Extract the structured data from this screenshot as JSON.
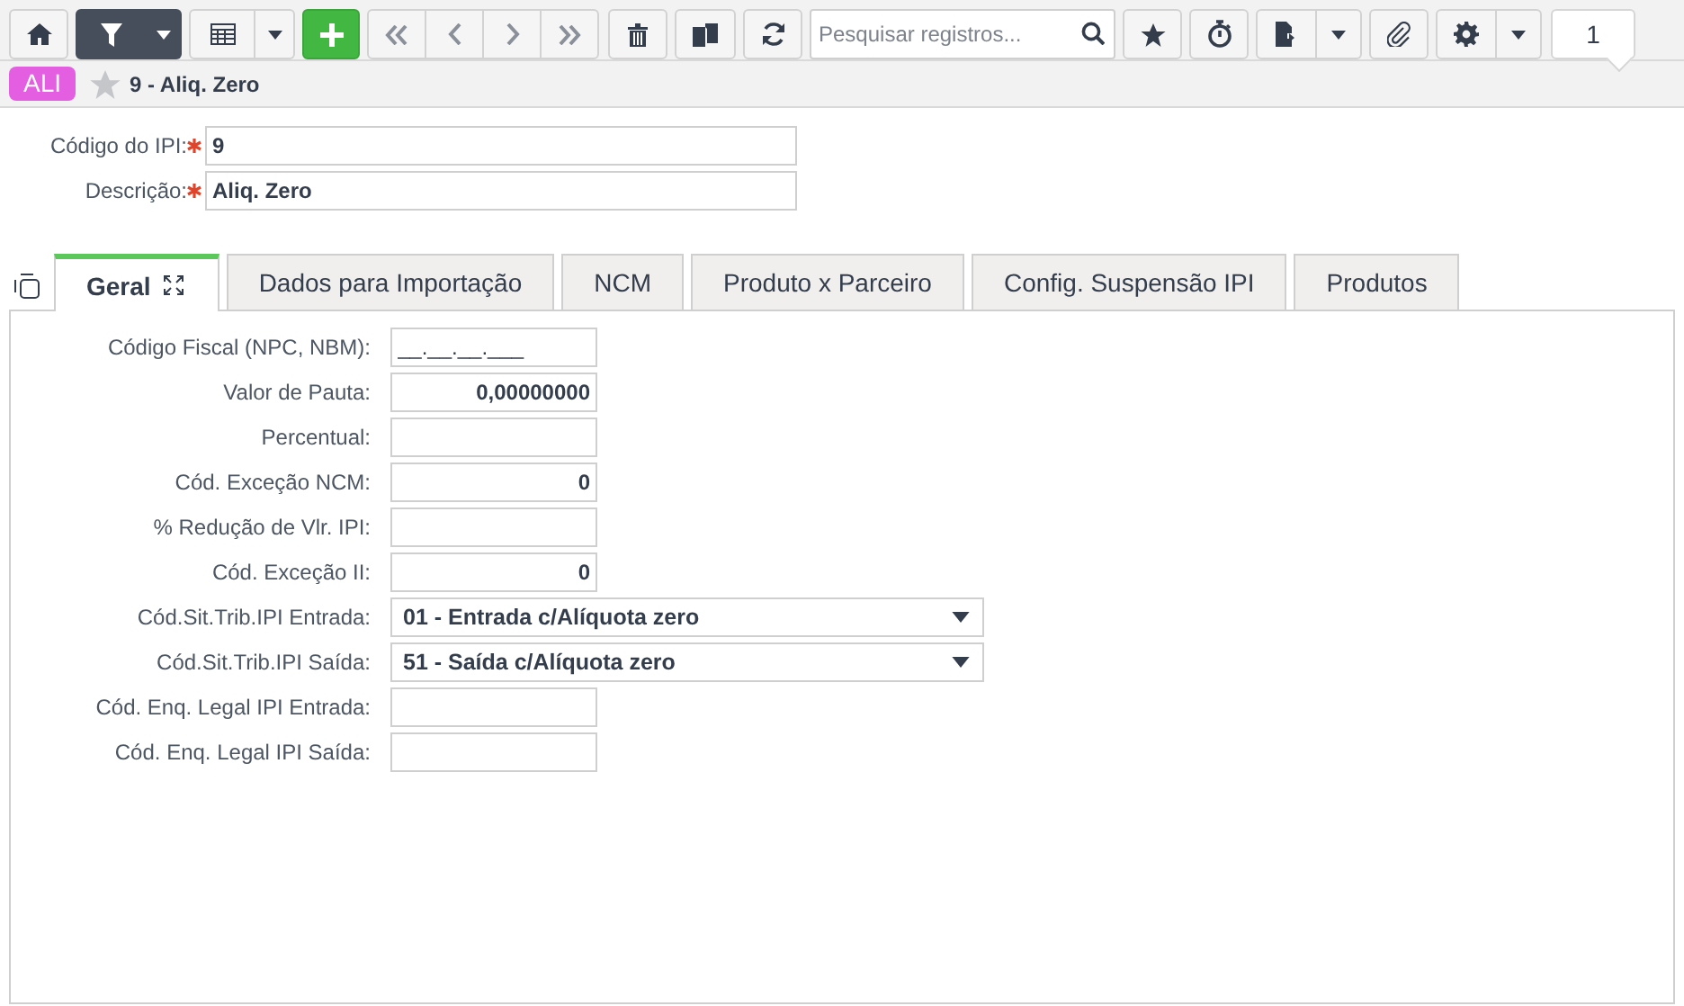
{
  "toolbar": {
    "filter_active": true,
    "search": {
      "placeholder": "Pesquisar registros..."
    },
    "record_count": "1"
  },
  "breadcrumb": {
    "badge": "ALI",
    "favorite": false,
    "title": "9 - Aliq. Zero"
  },
  "header_fields": [
    {
      "label": "Código do IPI:",
      "required": true,
      "value": "9"
    },
    {
      "label": "Descrição:",
      "required": true,
      "value": "Aliq. Zero"
    }
  ],
  "tabs": [
    {
      "label": "Geral",
      "selected": true
    },
    {
      "label": "Dados para Importação",
      "selected": false
    },
    {
      "label": "NCM",
      "selected": false
    },
    {
      "label": "Produto x Parceiro",
      "selected": false
    },
    {
      "label": "Config. Suspensão IPI",
      "selected": false
    },
    {
      "label": "Produtos",
      "selected": false
    }
  ],
  "fields": [
    {
      "kind": "text",
      "label": "Código Fiscal (NPC, NBM):",
      "value": "__.__.__.___"
    },
    {
      "kind": "number",
      "label": "Valor de Pauta:",
      "value": "0,00000000"
    },
    {
      "kind": "number",
      "label": "Percentual:"
    },
    {
      "kind": "number",
      "label": "Cód. Exceção NCM:",
      "value": "0"
    },
    {
      "kind": "number",
      "label": "% Redução de Vlr. IPI:"
    },
    {
      "kind": "number",
      "label": "Cód. Exceção II:",
      "value": "0"
    },
    {
      "kind": "select",
      "label": "Cód.Sit.Trib.IPI Entrada:",
      "value": "01 - Entrada c/Alíquota zero"
    },
    {
      "kind": "select",
      "label": "Cód.Sit.Trib.IPI Saída:",
      "value": "51 - Saída c/Alíquota zero"
    },
    {
      "kind": "text",
      "label": "Cód. Enq. Legal IPI Entrada:"
    },
    {
      "kind": "text",
      "label": "Cód. Enq. Legal IPI Saída:"
    }
  ]
}
